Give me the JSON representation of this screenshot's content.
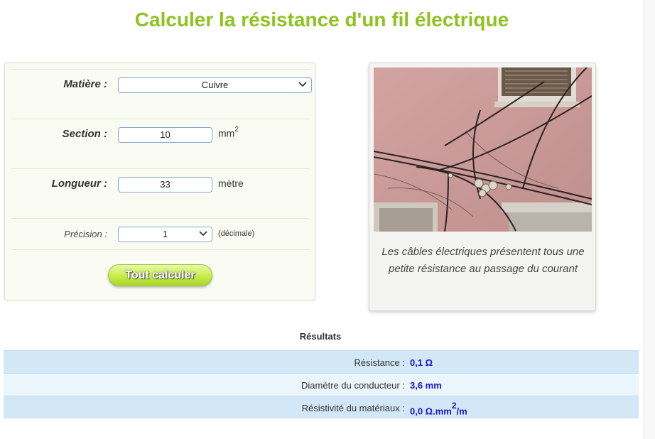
{
  "page": {
    "title": "Calculer la résistance d'un fil électrique"
  },
  "form": {
    "matiere": {
      "label": "Matière :",
      "value": "Cuivre"
    },
    "section": {
      "label": "Section :",
      "value": "10",
      "unit": "mm",
      "unit_exponent": "2"
    },
    "longueur": {
      "label": "Longueur :",
      "value": "33",
      "unit": "mètre"
    },
    "precision": {
      "label": "Précision :",
      "value": "1",
      "unit": "(décimale)"
    },
    "calculate_button": "Tout calculer"
  },
  "photo_card": {
    "caption": "Les câbles électriques présentent tous une petite résistance au passage du courant"
  },
  "results": {
    "title": "Résultats",
    "rows": [
      {
        "label": "Résistance :",
        "value": "0,1 Ω"
      },
      {
        "label": "Diamètre du conducteur :",
        "value": "3,6 mm"
      },
      {
        "label": "Résistivité du matériaux :",
        "value_prefix": "0,0 Ω.mm",
        "value_exponent": "2",
        "value_suffix": "/m"
      }
    ]
  },
  "colors": {
    "title_green": "#8dc21f",
    "result_blue": "#1515d6",
    "row_even": "#d3e8f6",
    "row_odd": "#ebf5fc"
  },
  "icons": {
    "select_arrow": "chevron-down-icon"
  }
}
